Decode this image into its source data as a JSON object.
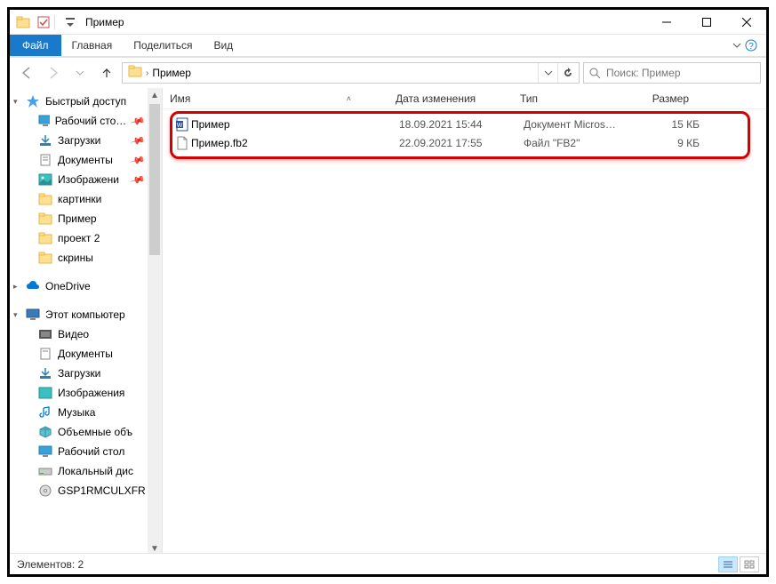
{
  "window": {
    "title": "Пример"
  },
  "ribbon": {
    "file": "Файл",
    "tabs": [
      "Главная",
      "Поделиться",
      "Вид"
    ]
  },
  "address": {
    "crumb": "Пример",
    "search_placeholder": "Поиск: Пример"
  },
  "sidebar": {
    "quick_access": "Быстрый доступ",
    "quick_items": [
      {
        "label": "Рабочий сто…",
        "icon": "desktop",
        "pinned": true
      },
      {
        "label": "Загрузки",
        "icon": "downloads",
        "pinned": true
      },
      {
        "label": "Документы",
        "icon": "documents",
        "pinned": true
      },
      {
        "label": "Изображени",
        "icon": "pictures",
        "pinned": true
      },
      {
        "label": "картинки",
        "icon": "folder",
        "pinned": false
      },
      {
        "label": "Пример",
        "icon": "folder",
        "pinned": false
      },
      {
        "label": "проект 2",
        "icon": "folder",
        "pinned": false
      },
      {
        "label": "скрины",
        "icon": "folder",
        "pinned": false
      }
    ],
    "onedrive": "OneDrive",
    "this_pc": "Этот компьютер",
    "pc_items": [
      {
        "label": "Видео",
        "icon": "video"
      },
      {
        "label": "Документы",
        "icon": "documents"
      },
      {
        "label": "Загрузки",
        "icon": "downloads"
      },
      {
        "label": "Изображения",
        "icon": "pictures"
      },
      {
        "label": "Музыка",
        "icon": "music"
      },
      {
        "label": "Объемные объ",
        "icon": "3d"
      },
      {
        "label": "Рабочий стол",
        "icon": "desktop"
      },
      {
        "label": "Локальный дис",
        "icon": "disk"
      },
      {
        "label": "GSP1RMCULXFR",
        "icon": "cd"
      }
    ]
  },
  "columns": {
    "name": "Имя",
    "date": "Дата изменения",
    "type": "Тип",
    "size": "Размер"
  },
  "files": [
    {
      "name": "Пример",
      "date": "18.09.2021 15:44",
      "type": "Документ Micros…",
      "size": "15 КБ",
      "icon": "word"
    },
    {
      "name": "Пример.fb2",
      "date": "22.09.2021 17:55",
      "type": "Файл \"FB2\"",
      "size": "9 КБ",
      "icon": "file"
    }
  ],
  "status": {
    "count_label": "Элементов: 2"
  }
}
